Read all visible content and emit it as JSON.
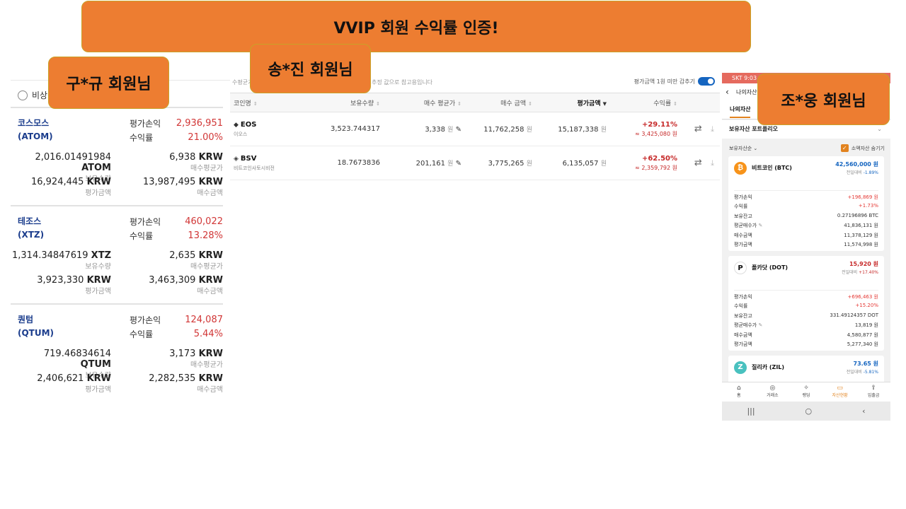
{
  "banners": {
    "title": "VVIP 회원 수익률 인증!",
    "left": "구*규 회원님",
    "middle": "송*진 회원님",
    "right": "조*웅 회원님"
  },
  "left_panel": {
    "option_label": "비상장",
    "coins": [
      {
        "name": "코스모스",
        "ticker": "(ATOM)",
        "pl_label": "평가손익",
        "pl_value": "2,936,951",
        "rate_label": "수익률",
        "rate_value": "21.00%",
        "qty": "2,016.01491984",
        "qty_unit": "ATOM",
        "qty_label": "보유수량",
        "avg": "6,938",
        "avg_unit": "KRW",
        "avg_label": "매수평균가",
        "eval": "16,924,445",
        "eval_unit": "KRW",
        "eval_label": "평가금액",
        "buy": "13,987,495",
        "buy_unit": "KRW",
        "buy_label": "매수금액"
      },
      {
        "name": "테조스",
        "ticker": "(XTZ)",
        "pl_label": "평가손익",
        "pl_value": "460,022",
        "rate_label": "수익률",
        "rate_value": "13.28%",
        "qty": "1,314.34847619",
        "qty_unit": "XTZ",
        "qty_label": "보유수량",
        "avg": "2,635",
        "avg_unit": "KRW",
        "avg_label": "매수평균가",
        "eval": "3,923,330",
        "eval_unit": "KRW",
        "eval_label": "평가금액",
        "buy": "3,463,309",
        "buy_unit": "KRW",
        "buy_label": "매수금액"
      },
      {
        "name": "퀀텀",
        "ticker": "(QTUM)",
        "pl_label": "평가손익",
        "pl_value": "124,087",
        "rate_label": "수익률",
        "rate_value": "5.44%",
        "qty": "719.46834614",
        "qty_unit": "QTUM",
        "qty_label": "보유수량",
        "avg": "3,173",
        "avg_unit": "KRW",
        "avg_label": "매수평균가",
        "eval": "2,406,621",
        "eval_unit": "KRW",
        "eval_label": "평가금액",
        "buy": "2,282,535",
        "buy_unit": "KRW",
        "buy_label": "매수금액"
      }
    ]
  },
  "middle_panel": {
    "note_start": "수평균가",
    "note_end": "추정 값으로 참고용입니다",
    "toggle_label": "평가금액 1원 미만 감추기",
    "headers": [
      "코인명",
      "보유수량",
      "매수 평균가",
      "매수 금액",
      "평가금액",
      "수익률"
    ],
    "rows": [
      {
        "ticker": "EOS",
        "name": "이오스",
        "qty": "3,523.744317",
        "avg": "3,338",
        "buy": "11,762,258",
        "eval": "15,187,338",
        "rate": "+29.11%",
        "profit": "≈ 3,425,080 원"
      },
      {
        "ticker": "BSV",
        "name": "비트코인사토시비전",
        "qty": "18.7673836",
        "avg": "201,161",
        "buy": "3,775,265",
        "eval": "6,135,057",
        "rate": "+62.50%",
        "profit": "≈ 2,359,792 원"
      }
    ],
    "won": "원"
  },
  "phone": {
    "status": "SKT 9:03",
    "header": "나의자산",
    "tab_active": "나의자산",
    "tab_right": "기",
    "portfolio": "보유자산 포트폴리오",
    "sort_label": "보유자산순",
    "hide_small": "소액자산 숨기기",
    "cards": [
      {
        "name": "비트코인 (BTC)",
        "price": "42,560,000 원",
        "change_label": "전일대비",
        "change": "-1.89%",
        "rows": [
          [
            "평가손익",
            "+196,869 원"
          ],
          [
            "수익률",
            "+1.73%"
          ],
          [
            "보유잔고",
            "0.27196896 BTC"
          ],
          [
            "평균매수가",
            "41,836,131 원"
          ],
          [
            "매수금액",
            "11,378,129 원"
          ],
          [
            "평가금액",
            "11,574,998 원"
          ]
        ]
      },
      {
        "name": "폴카닷 (DOT)",
        "price": "15,920 원",
        "change_label": "전일대비",
        "change": "+17.40%",
        "rows": [
          [
            "평가손익",
            "+696,463 원"
          ],
          [
            "수익률",
            "+15.20%"
          ],
          [
            "보유잔고",
            "331.49124357 DOT"
          ],
          [
            "평균매수가",
            "13,819 원"
          ],
          [
            "매수금액",
            "4,580,877 원"
          ],
          [
            "평가금액",
            "5,277,340 원"
          ]
        ]
      },
      {
        "name": "질리카 (ZIL)",
        "price": "73.65 원",
        "change_label": "전일대비",
        "change": "-5.81%"
      }
    ],
    "nav": [
      "홈",
      "거래소",
      "랭딩",
      "자산현황",
      "입출금"
    ]
  },
  "colors": {
    "banner": "#ed7d31",
    "loss_red": "#d13636",
    "blue": "#1565c0",
    "accent": "#e2831f"
  }
}
